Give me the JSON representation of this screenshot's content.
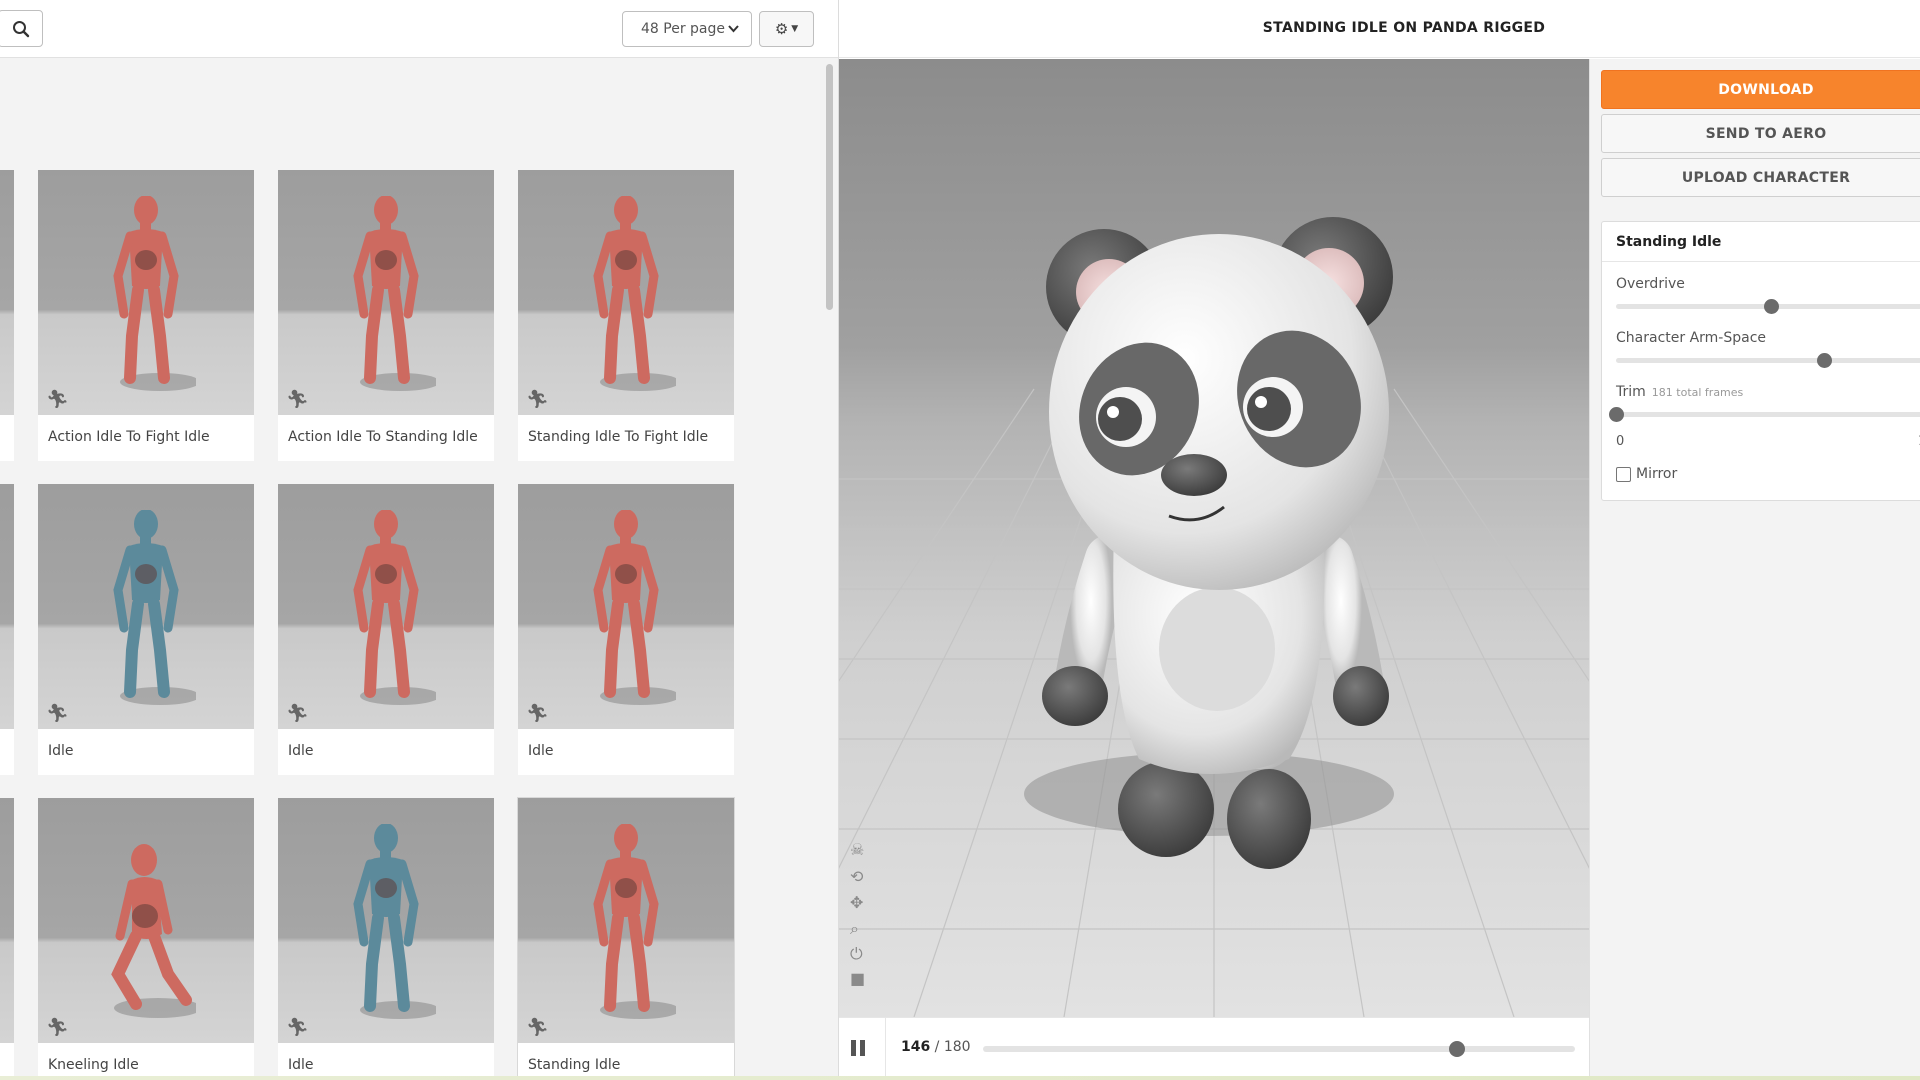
{
  "toolbar": {
    "per_page_label": "48 Per page",
    "search_icon": "search-icon",
    "settings_icon": "gear-icon"
  },
  "grid": {
    "cards": [
      {
        "label": "Action Idle To Fight Idle",
        "figure_color": "#cd6a60"
      },
      {
        "label": "Action Idle To Standing Idle",
        "figure_color": "#cd6a60"
      },
      {
        "label": "Standing Idle To Fight Idle",
        "figure_color": "#cd6a60"
      },
      {
        "label": "Idle",
        "figure_color": "#5c8a9b"
      },
      {
        "label": "Idle",
        "figure_color": "#cd6a60"
      },
      {
        "label": "Idle",
        "figure_color": "#cd6a60"
      },
      {
        "label": "Kneeling Idle",
        "figure_color": "#cd6a60"
      },
      {
        "label": "Idle",
        "figure_color": "#5c8a9b"
      },
      {
        "label": "Standing Idle",
        "figure_color": "#cd6a60",
        "selected": true
      }
    ]
  },
  "viewer": {
    "title": "STANDING IDLE ON PANDA RIGGED",
    "tools": [
      "skull-icon",
      "rotate-icon",
      "pan-icon",
      "zoom-icon",
      "reset-icon",
      "camera-icon"
    ]
  },
  "player": {
    "current_frame": "146",
    "frame_separator": " / ",
    "total_frames": "180",
    "progress": 0.8
  },
  "panel": {
    "download_label": "DOWNLOAD",
    "send_to_aero_label": "SEND TO AERO",
    "upload_character_label": "UPLOAD CHARACTER",
    "animation_name": "Standing Idle",
    "overdrive_label": "Overdrive",
    "overdrive_value": 0.5,
    "arm_space_label": "Character Arm-Space",
    "arm_space_value": 0.67,
    "trim_label": "Trim",
    "trim_hint": "181 total frames",
    "trim_start": "0",
    "trim_end": "1",
    "mirror_label": "Mirror",
    "mirror_checked": false
  },
  "colors": {
    "accent": "#f7842c",
    "red_figure": "#cd6a60",
    "blue_figure": "#5c8a9b"
  }
}
